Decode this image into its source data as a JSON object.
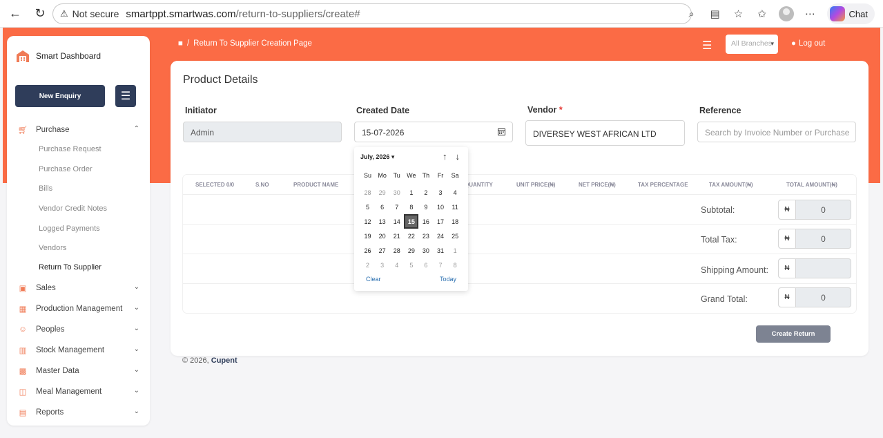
{
  "browser": {
    "not_secure": "Not secure",
    "host": "smartppt.smartwas.com",
    "path": "/return-to-suppliers/create#",
    "chat_label": "Chat"
  },
  "sidebar": {
    "brand": "Smart Dashboard",
    "new_enquiry": "New Enquiry",
    "purchase": "Purchase",
    "purchase_sub": [
      "Purchase Request",
      "Purchase Order",
      "Bills",
      "Vendor Credit Notes",
      "Logged Payments",
      "Vendors",
      "Return To Supplier"
    ],
    "sales": "Sales",
    "production": "Production Management",
    "peoples": "Peoples",
    "stock": "Stock Management",
    "master": "Master Data",
    "meal": "Meal Management",
    "reports": "Reports"
  },
  "header": {
    "breadcrumb": "Return To Supplier Creation Page",
    "branch_placeholder": "All Branches",
    "logout": "Log out"
  },
  "form": {
    "title": "Product Details",
    "initiator_label": "Initiator",
    "initiator_value": "Admin",
    "created_date_label": "Created Date",
    "created_date_value": "15-07-2026",
    "vendor_label": "Vendor",
    "vendor_required": "*",
    "vendor_value": "DIVERSEY WEST AFRICAN LTD",
    "reference_label": "Reference",
    "reference_placeholder": "Search by Invoice Number or Purchase"
  },
  "table": {
    "columns": [
      "SELECTED 0/0",
      "S.NO",
      "PRODUCT NAME",
      "QUANTITY",
      "UNIT PRICE(₦)",
      "NET PRICE(₦)",
      "TAX PERCENTAGE",
      "TAX AMOUNT(₦)",
      "TOTAL AMOUNT(₦)"
    ]
  },
  "totals": {
    "currency": "₦",
    "subtotal_label": "Subtotal:",
    "subtotal_value": "0",
    "tax_label": "Total Tax:",
    "tax_value": "0",
    "shipping_label": "Shipping Amount:",
    "shipping_value": "",
    "grand_label": "Grand Total:",
    "grand_value": "0"
  },
  "create_button": "Create Return",
  "footer": {
    "copyright": "© 2026,",
    "company": "Cupent"
  },
  "datepicker": {
    "month": "July, 2026",
    "weekdays": [
      "Su",
      "Mo",
      "Tu",
      "We",
      "Th",
      "Fr",
      "Sa"
    ],
    "days": [
      "28",
      "29",
      "30",
      "1",
      "2",
      "3",
      "4",
      "5",
      "6",
      "7",
      "8",
      "9",
      "10",
      "11",
      "12",
      "13",
      "14",
      "15",
      "16",
      "17",
      "18",
      "19",
      "20",
      "21",
      "22",
      "23",
      "24",
      "25",
      "26",
      "27",
      "28",
      "29",
      "30",
      "31",
      "1",
      "2",
      "3",
      "4",
      "5",
      "6",
      "7",
      "8"
    ],
    "muted_indices": [
      0,
      1,
      2,
      34,
      35,
      36,
      37,
      38,
      39,
      40,
      41
    ],
    "selected_index": 17,
    "clear": "Clear",
    "today": "Today"
  },
  "colors": {
    "accent": "#fb6b45",
    "navy": "#2f3d5a"
  }
}
